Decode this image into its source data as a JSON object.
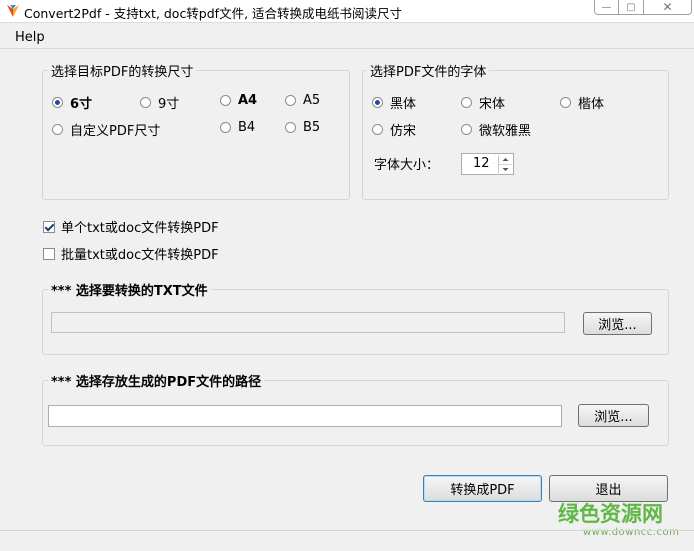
{
  "window": {
    "title": "Convert2Pdf - 支持txt, doc转pdf文件, 适合转换成电纸书阅读尺寸",
    "minimize_label": "—",
    "maximize_label": "▢",
    "close_label": "✕"
  },
  "menu": {
    "help": "Help"
  },
  "size_group": {
    "legend": "选择目标PDF的转换尺寸",
    "options": [
      {
        "label": "6寸",
        "selected": true
      },
      {
        "label": "9寸",
        "selected": false
      },
      {
        "label": "A4",
        "selected": false
      },
      {
        "label": "A5",
        "selected": false
      },
      {
        "label": "自定义PDF尺寸",
        "selected": false
      },
      {
        "label": "B4",
        "selected": false
      },
      {
        "label": "B5",
        "selected": false
      }
    ]
  },
  "font_group": {
    "legend": "选择PDF文件的字体",
    "options": [
      {
        "label": "黑体",
        "selected": true
      },
      {
        "label": "宋体",
        "selected": false
      },
      {
        "label": "楷体",
        "selected": false
      },
      {
        "label": "仿宋",
        "selected": false
      },
      {
        "label": "微软雅黑",
        "selected": false
      }
    ],
    "size_label": "字体大小：",
    "size_value": "12"
  },
  "mode": {
    "single_label": "单个txt或doc文件转换PDF",
    "single_checked": true,
    "batch_label": "批量txt或doc文件转换PDF",
    "batch_checked": false
  },
  "txt_group": {
    "legend": "*** 选择要转换的TXT文件",
    "path_value": "",
    "browse_label": "浏览..."
  },
  "pdf_group": {
    "legend": "*** 选择存放生成的PDF文件的路径",
    "path_value": "",
    "browse_label": "浏览..."
  },
  "actions": {
    "convert_label": "转换成PDF",
    "exit_label": "退出"
  },
  "watermark": {
    "brand": "绿色资源网",
    "url": "www.downcc.com"
  },
  "colors": {
    "radio_dot": "#1c4f9c",
    "watermark_green": "#5fb845",
    "focus_border": "#3c7fb1"
  }
}
